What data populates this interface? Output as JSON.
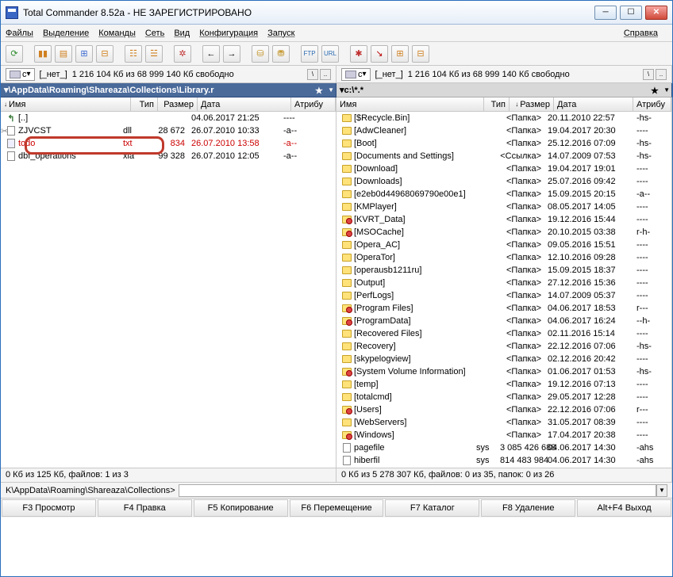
{
  "window": {
    "title": "Total Commander 8.52a - НЕ ЗАРЕГИСТРИРОВАНО"
  },
  "menu": {
    "items": [
      "Файлы",
      "Выделение",
      "Команды",
      "Сеть",
      "Вид",
      "Конфигурация",
      "Запуск"
    ],
    "help": "Справка"
  },
  "toolbar": {
    "icons": [
      "refresh",
      "view-brief",
      "view-full",
      "view-thumbs",
      "tree",
      "swap",
      "sep",
      "brief",
      "full",
      "sep",
      "back",
      "fwd",
      "sep",
      "pack",
      "unpack",
      "sep",
      "ftp",
      "url",
      "sep",
      "star",
      "wand",
      "mmedia"
    ]
  },
  "drive": {
    "letter": "c",
    "none": "[_нет_]",
    "free": "1 216 104 Кб из 68 999 140 Кб свободно"
  },
  "left": {
    "path": "\\AppData\\Roaming\\Shareaza\\Collections\\Library.r",
    "cols": {
      "name": "Имя",
      "ext": "Тип",
      "size": "Размер",
      "date": "Дата",
      "attr": "Атрибу"
    },
    "colw": {
      "name": 150,
      "ext": 34,
      "size": 50,
      "date": 118,
      "attr": 40
    },
    "rows": [
      {
        "icon": "up",
        "name": "[..]",
        "ext": "",
        "size": "",
        "date": "04.06.2017 21:25",
        "attr": "----"
      },
      {
        "icon": "file",
        "name": "ZJVCST",
        "ext": "dll",
        "size": "28 672",
        "date": "26.07.2010 10:33",
        "attr": "-a--",
        "cut": true
      },
      {
        "icon": "txt",
        "name": "todo",
        "ext": "txt",
        "size": "834",
        "date": "26.07.2010 13:58",
        "attr": "-a--",
        "selected": true,
        "highlight": true
      },
      {
        "icon": "file",
        "name": "dbf_operations",
        "ext": "xla",
        "size": "99 328",
        "date": "26.07.2010 12:05",
        "attr": "-a--"
      }
    ],
    "status": "0 Кб из 125 Кб, файлов: 1 из 3"
  },
  "right": {
    "path": "c:\\*.*",
    "cols": {
      "name": "Имя",
      "ext": "Тип",
      "size": "Размер",
      "date": "Дата",
      "attr": "Атрибу"
    },
    "colw": {
      "name": 172,
      "ext": 32,
      "size": 56,
      "date": 114,
      "attr": 40
    },
    "rows": [
      {
        "icon": "fold",
        "name": "[$Recycle.Bin]",
        "ext": "",
        "size": "<Папка>",
        "date": "20.11.2010 22:57",
        "attr": "-hs-"
      },
      {
        "icon": "fold",
        "name": "[AdwCleaner]",
        "ext": "",
        "size": "<Папка>",
        "date": "19.04.2017 20:30",
        "attr": "----"
      },
      {
        "icon": "fold",
        "name": "[Boot]",
        "ext": "",
        "size": "<Папка>",
        "date": "25.12.2016 07:09",
        "attr": "-hs-"
      },
      {
        "icon": "link",
        "name": "[Documents and Settings]",
        "ext": "",
        "size": "<Ссылка>",
        "date": "14.07.2009 07:53",
        "attr": "-hs-"
      },
      {
        "icon": "fold",
        "name": "[Download]",
        "ext": "",
        "size": "<Папка>",
        "date": "19.04.2017 19:01",
        "attr": "----"
      },
      {
        "icon": "fold",
        "name": "[Downloads]",
        "ext": "",
        "size": "<Папка>",
        "date": "25.07.2016 09:42",
        "attr": "----"
      },
      {
        "icon": "fold",
        "name": "[e2eb0d44968069790e00e1]",
        "ext": "",
        "size": "<Папка>",
        "date": "15.09.2015 20:15",
        "attr": "-a--"
      },
      {
        "icon": "fold",
        "name": "[KMPlayer]",
        "ext": "",
        "size": "<Папка>",
        "date": "08.05.2017 14:05",
        "attr": "----"
      },
      {
        "icon": "foldp",
        "name": "[KVRT_Data]",
        "ext": "",
        "size": "<Папка>",
        "date": "19.12.2016 15:44",
        "attr": "----"
      },
      {
        "icon": "foldp",
        "name": "[MSOCache]",
        "ext": "",
        "size": "<Папка>",
        "date": "20.10.2015 03:38",
        "attr": "r-h-"
      },
      {
        "icon": "fold",
        "name": "[Opera_AC]",
        "ext": "",
        "size": "<Папка>",
        "date": "09.05.2016 15:51",
        "attr": "----"
      },
      {
        "icon": "fold",
        "name": "[OperaTor]",
        "ext": "",
        "size": "<Папка>",
        "date": "12.10.2016 09:28",
        "attr": "----"
      },
      {
        "icon": "fold",
        "name": "[operausb1211ru]",
        "ext": "",
        "size": "<Папка>",
        "date": "15.09.2015 18:37",
        "attr": "----"
      },
      {
        "icon": "fold",
        "name": "[Output]",
        "ext": "",
        "size": "<Папка>",
        "date": "27.12.2016 15:36",
        "attr": "----"
      },
      {
        "icon": "fold",
        "name": "[PerfLogs]",
        "ext": "",
        "size": "<Папка>",
        "date": "14.07.2009 05:37",
        "attr": "----"
      },
      {
        "icon": "foldp",
        "name": "[Program Files]",
        "ext": "",
        "size": "<Папка>",
        "date": "04.06.2017 18:53",
        "attr": "r---"
      },
      {
        "icon": "foldp",
        "name": "[ProgramData]",
        "ext": "",
        "size": "<Папка>",
        "date": "04.06.2017 16:24",
        "attr": "--h-"
      },
      {
        "icon": "fold",
        "name": "[Recovered Files]",
        "ext": "",
        "size": "<Папка>",
        "date": "02.11.2016 15:14",
        "attr": "----"
      },
      {
        "icon": "fold",
        "name": "[Recovery]",
        "ext": "",
        "size": "<Папка>",
        "date": "22.12.2016 07:06",
        "attr": "-hs-"
      },
      {
        "icon": "fold",
        "name": "[skypelogview]",
        "ext": "",
        "size": "<Папка>",
        "date": "02.12.2016 20:42",
        "attr": "----"
      },
      {
        "icon": "foldp",
        "name": "[System Volume Information]",
        "ext": "",
        "size": "<Папка>",
        "date": "01.06.2017 01:53",
        "attr": "-hs-"
      },
      {
        "icon": "fold",
        "name": "[temp]",
        "ext": "",
        "size": "<Папка>",
        "date": "19.12.2016 07:13",
        "attr": "----"
      },
      {
        "icon": "fold",
        "name": "[totalcmd]",
        "ext": "",
        "size": "<Папка>",
        "date": "29.05.2017 12:28",
        "attr": "----"
      },
      {
        "icon": "foldp",
        "name": "[Users]",
        "ext": "",
        "size": "<Папка>",
        "date": "22.12.2016 07:06",
        "attr": "r---"
      },
      {
        "icon": "fold",
        "name": "[WebServers]",
        "ext": "",
        "size": "<Папка>",
        "date": "31.05.2017 08:39",
        "attr": "----"
      },
      {
        "icon": "foldp",
        "name": "[Windows]",
        "ext": "",
        "size": "<Папка>",
        "date": "17.04.2017 20:38",
        "attr": "----"
      },
      {
        "icon": "file",
        "name": "pagefile",
        "ext": "sys",
        "size": "3 085 426 688",
        "date": "04.06.2017 14:30",
        "attr": "-ahs"
      },
      {
        "icon": "file",
        "name": "hiberfil",
        "ext": "sys",
        "size": "814 483 984",
        "date": "04.06.2017 14:30",
        "attr": "-ahs"
      }
    ],
    "status": "0 Кб из 5 278 307 Кб, файлов: 0 из 35, папок: 0 из 26"
  },
  "cmdline": {
    "prompt": "K\\AppData\\Roaming\\Shareaza\\Collections>"
  },
  "fkeys": [
    "F3 Просмотр",
    "F4 Правка",
    "F5 Копирование",
    "F6 Перемещение",
    "F7 Каталог",
    "F8 Удаление",
    "Alt+F4 Выход"
  ]
}
